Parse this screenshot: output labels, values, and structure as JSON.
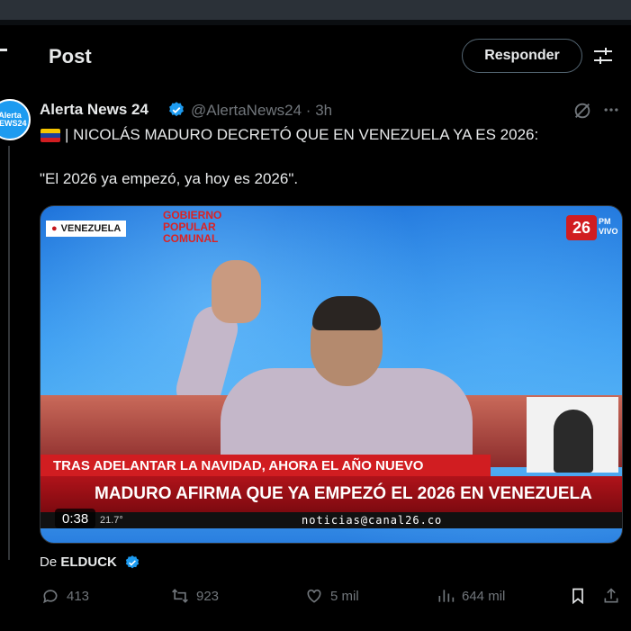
{
  "header": {
    "title": "Post",
    "reply_button": "Responder"
  },
  "tweet": {
    "author_name": "Alerta News 24",
    "avatar_text": "Alerta NEWS24",
    "handle_time": "@AlertaNews24 · 3h",
    "line1": "| NICOLÁS MADURO DECRETÓ QUE EN VENEZUELA YA ES 2026:",
    "line2": "\"El 2026 ya empezó, ya hoy es 2026\".",
    "video": {
      "location": "VENEZUELA",
      "gov_logo": "GOBIERNO POPULAR COMUNAL",
      "channel": "26",
      "channel_sub": "PM VIVO",
      "lower_third_1": "TRAS ADELANTAR LA NAVIDAD, AHORA EL AÑO NUEVO",
      "lower_third_2": "MADURO AFIRMA QUE YA EMPEZÓ EL 2026 EN VENEZUELA",
      "ticker_temp": "21.7°",
      "ticker_email": "noticias@canal26.co",
      "duration": "0:38"
    },
    "source_prefix": "De",
    "source_name": "ELDUCK",
    "actions": {
      "replies": "413",
      "reposts": "923",
      "likes": "5 mil",
      "views": "644 mil"
    }
  },
  "colors": {
    "accent": "#1d9bf0",
    "muted": "#71767b",
    "red": "#d11d21"
  }
}
